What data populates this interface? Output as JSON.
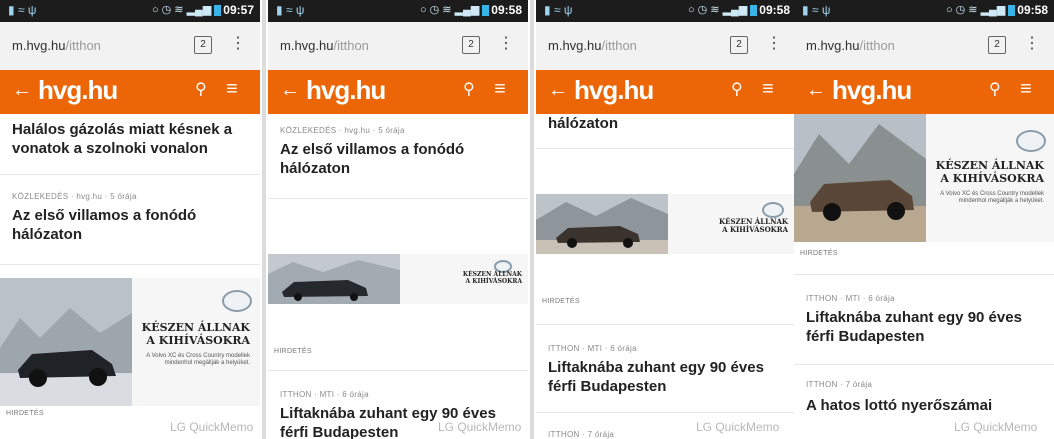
{
  "colors": {
    "brand_orange": "#ec6608",
    "status_bar": "#1c1c1c",
    "address_bar": "#f2f2f2"
  },
  "browser": {
    "url_host": "m.hvg.hu",
    "url_path": "/itthon",
    "tab_count": "2"
  },
  "site": {
    "logo": "hvg.hu"
  },
  "ad": {
    "headline_1": "KÉSZEN ÁLLNAK",
    "headline_2": "A KIHÍVÁSOKRA",
    "tagline": "A Volvo XC és Cross Country modellek mindenhol megállják a helyüket.",
    "label": "HIRDETÉS"
  },
  "watermark": "LG QuickMemo",
  "screens": [
    {
      "time": "09:57",
      "article_top": {
        "title": "Halálos gázolás miatt késnek a vonatok a szolnoki vonalon"
      },
      "article_2": {
        "meta": "KÖZLEKEDÉS · hvg.hu · 5 órája",
        "title": "Az első villamos a fonódó hálózaton"
      }
    },
    {
      "time": "09:58",
      "article_1": {
        "meta": "KÖZLEKEDÉS · hvg.hu · 5 órája",
        "title": "Az első villamos a fonódó hálózaton"
      },
      "article_2": {
        "meta": "ITTHON · MTI · 6 órája",
        "title": "Liftaknába zuhant egy 90 éves férfi Budapesten"
      }
    },
    {
      "time": "09:58",
      "article_top": {
        "title": "hálózaton"
      },
      "article_2": {
        "meta": "ITTHON · MTI · 6 órája",
        "title": "Liftaknába zuhant egy 90 éves férfi Budapesten"
      },
      "article_3": {
        "meta": "ITTHON · 7 órája"
      }
    },
    {
      "time": "09:58",
      "article_2": {
        "meta": "ITTHON · MTI · 6 órája",
        "title": "Liftaknába zuhant egy 90 éves férfi Budapesten"
      },
      "article_3": {
        "meta": "ITTHON · 7 órája",
        "title": "A hatos lottó nyerőszámai"
      }
    }
  ]
}
